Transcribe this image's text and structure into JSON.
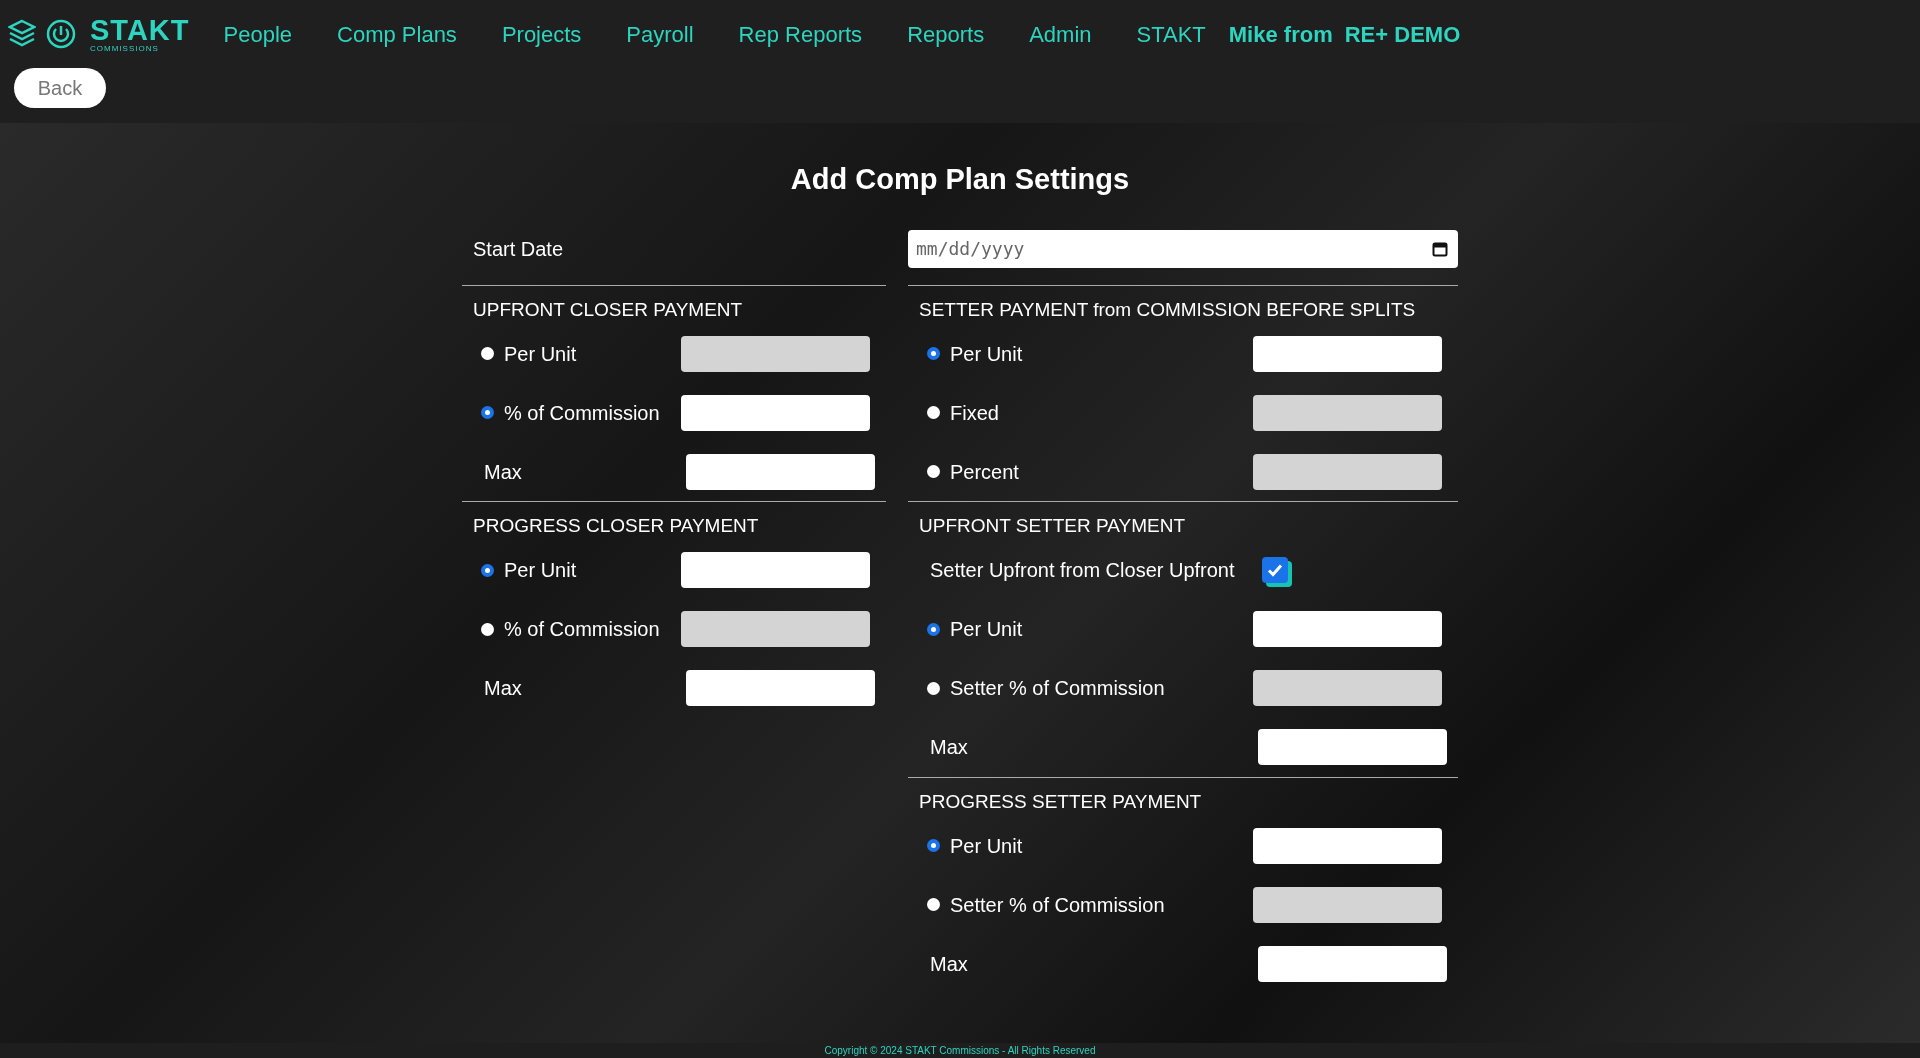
{
  "brand": {
    "name": "STAKT",
    "tagline": "COMMISSIONS"
  },
  "nav": [
    "People",
    "Comp Plans",
    "Projects",
    "Payroll",
    "Rep Reports",
    "Reports",
    "Admin",
    "STAKT"
  ],
  "user": {
    "greeting": "Mike from",
    "org": "RE+ DEMO"
  },
  "back": "Back",
  "title": "Add Comp Plan Settings",
  "start_date": {
    "label": "Start Date",
    "placeholder": "mm/dd/yyyy"
  },
  "columns": [
    [
      {
        "heading": "UPFRONT CLOSER PAYMENT",
        "rows": [
          {
            "kind": "radio",
            "label": "Per Unit",
            "selected": false
          },
          {
            "kind": "radio",
            "label": "% of Commission",
            "selected": true
          },
          {
            "kind": "max",
            "label": "Max"
          }
        ]
      },
      {
        "heading": "PROGRESS CLOSER PAYMENT",
        "rows": [
          {
            "kind": "radio",
            "label": "Per Unit",
            "selected": true
          },
          {
            "kind": "radio",
            "label": "% of Commission",
            "selected": false
          },
          {
            "kind": "max",
            "label": "Max"
          }
        ]
      }
    ],
    [
      {
        "heading": "SETTER PAYMENT from COMMISSION BEFORE SPLITS",
        "rows": [
          {
            "kind": "radio",
            "label": "Per Unit",
            "selected": true
          },
          {
            "kind": "radio",
            "label": "Fixed",
            "selected": false
          },
          {
            "kind": "radio",
            "label": "Percent",
            "selected": false
          }
        ]
      },
      {
        "heading": "UPFRONT SETTER PAYMENT",
        "rows": [
          {
            "kind": "checkbox",
            "label": "Setter Upfront from Closer Upfront",
            "checked": true
          },
          {
            "kind": "radio",
            "label": "Per Unit",
            "selected": true
          },
          {
            "kind": "radio",
            "label": "Setter % of Commission",
            "selected": false
          },
          {
            "kind": "max",
            "label": "Max"
          }
        ]
      },
      {
        "heading": "PROGRESS SETTER PAYMENT",
        "rows": [
          {
            "kind": "radio",
            "label": "Per Unit",
            "selected": true
          },
          {
            "kind": "radio",
            "label": "Setter % of Commission",
            "selected": false
          },
          {
            "kind": "max",
            "label": "Max"
          }
        ]
      }
    ]
  ],
  "footer": "Copyright © 2024 STAKT Commissions - All Rights Reserved"
}
